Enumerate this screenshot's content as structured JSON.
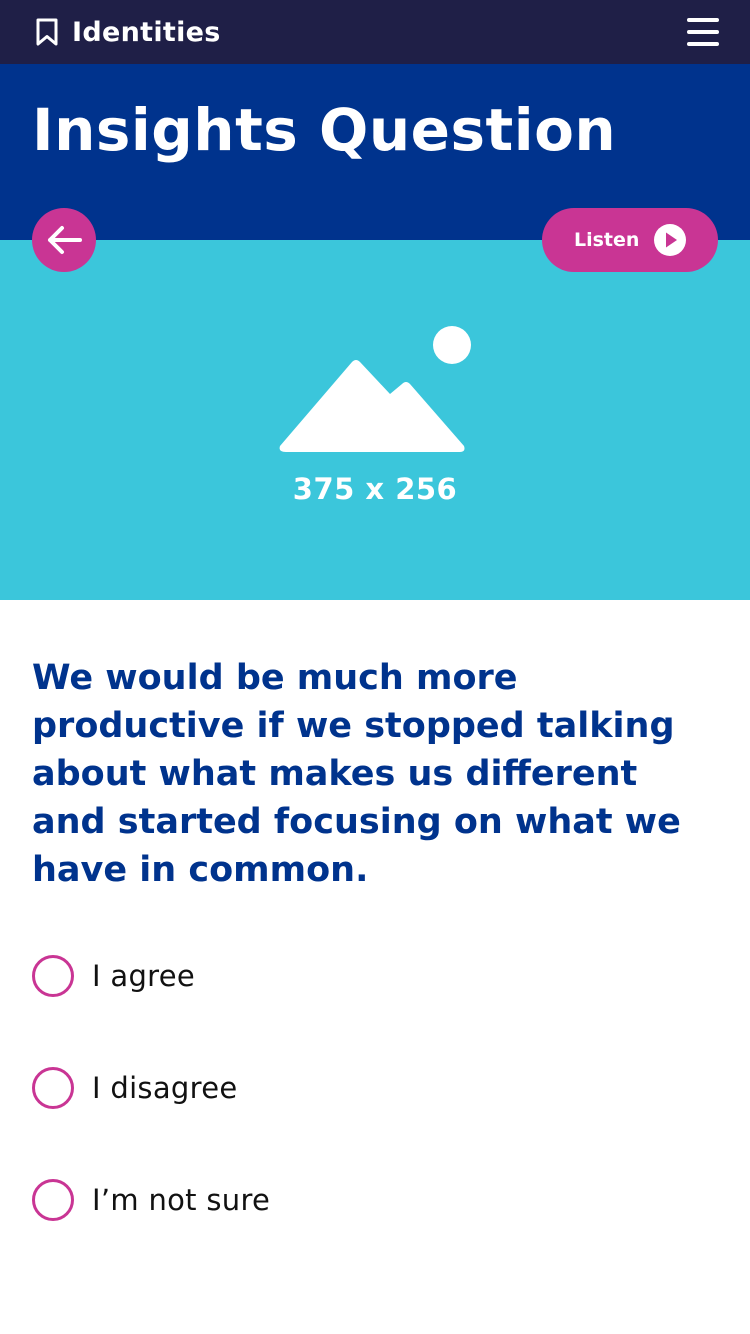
{
  "nav": {
    "brand_label": "Identities",
    "brand_icon": "bookmark-icon",
    "menu_icon": "hamburger-menu-icon"
  },
  "header": {
    "title": "Insights Question"
  },
  "controls": {
    "back_icon": "arrow-left-icon",
    "listen_label": "Listen",
    "listen_icon": "play-icon"
  },
  "hero": {
    "icon": "image-placeholder-icon",
    "caption": "375 x 256"
  },
  "question": {
    "text": "We would be much more productive if we stopped talking about what makes us different and started focusing on what we have in common.",
    "options": [
      {
        "label": "I agree",
        "selected": false
      },
      {
        "label": "I disagree",
        "selected": false
      },
      {
        "label": "I’m not sure",
        "selected": false
      }
    ]
  },
  "colors": {
    "nav_background": "#1f1f47",
    "header_background": "#00338d",
    "hero_background": "#3bc6db",
    "accent": "#c93594",
    "question_text": "#00338d"
  }
}
